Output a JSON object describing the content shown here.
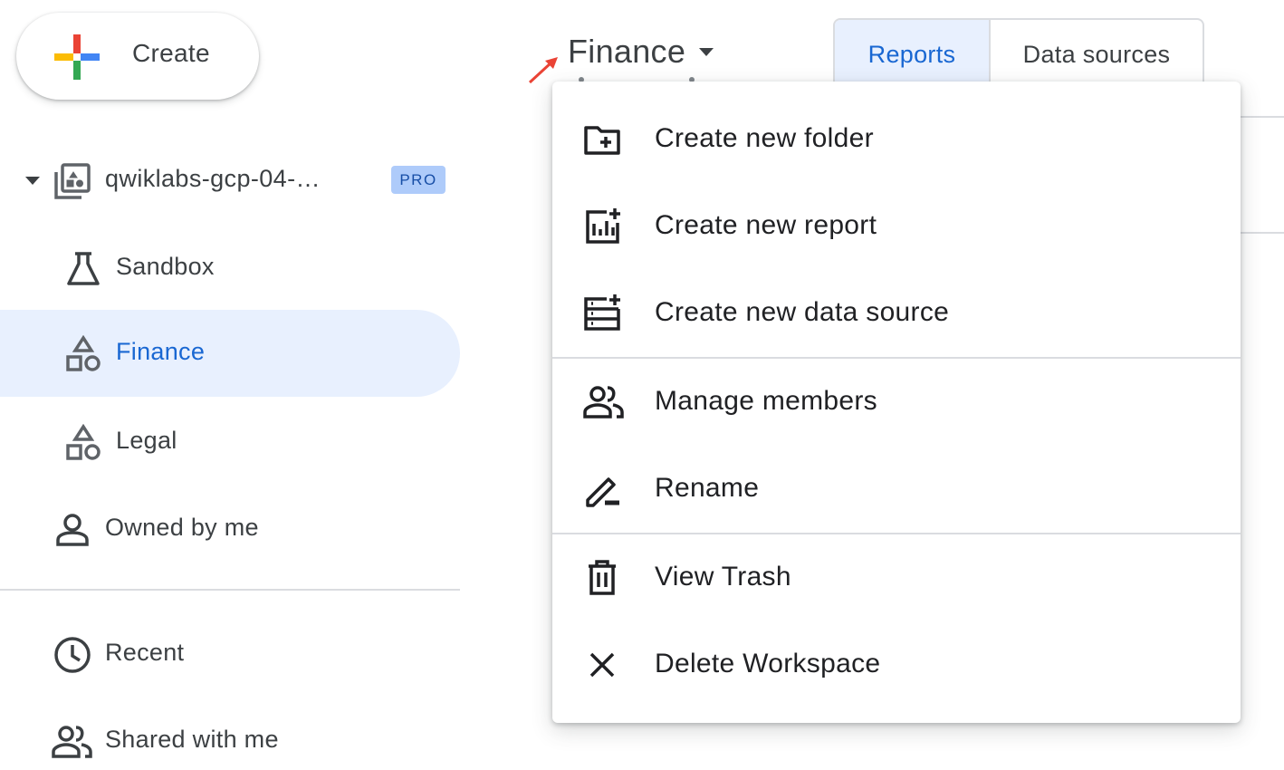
{
  "create_button": {
    "label": "Create"
  },
  "sidebar": {
    "workspace": {
      "name": "qwiklabs-gcp-04-…",
      "badge": "PRO"
    },
    "items": [
      {
        "label": "Sandbox",
        "icon": "flask-icon"
      },
      {
        "label": "Finance",
        "icon": "shapes-icon",
        "active": true
      },
      {
        "label": "Legal",
        "icon": "shapes-icon"
      },
      {
        "label": "Owned by me",
        "icon": "person-icon"
      }
    ],
    "bottom_items": [
      {
        "label": "Recent",
        "icon": "clock-icon"
      },
      {
        "label": "Shared with me",
        "icon": "people-icon"
      }
    ]
  },
  "header": {
    "title": "Finance",
    "tabs": [
      {
        "label": "Reports",
        "active": true
      },
      {
        "label": "Data sources",
        "active": false
      }
    ]
  },
  "menu": {
    "items": [
      {
        "label": "Create new folder",
        "icon": "folder-add-icon"
      },
      {
        "label": "Create new report",
        "icon": "chart-add-icon"
      },
      {
        "label": "Create new data source",
        "icon": "datasource-add-icon"
      },
      {
        "label": "Manage members",
        "icon": "people-icon"
      },
      {
        "label": "Rename",
        "icon": "pencil-icon"
      },
      {
        "label": "View Trash",
        "icon": "trash-icon"
      },
      {
        "label": "Delete Workspace",
        "icon": "close-icon"
      }
    ]
  },
  "colors": {
    "accent": "#1967d2",
    "active_bg": "#e8f0fe",
    "badge_bg": "#aecbfa",
    "annotation_arrow": "#ea4335"
  }
}
